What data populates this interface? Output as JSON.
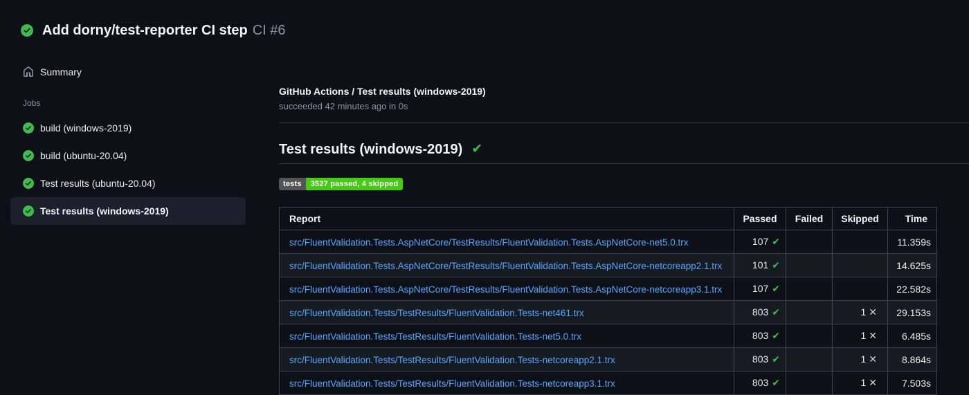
{
  "header": {
    "status_icon": "check-circle-icon",
    "title": "Add dorny/test-reporter CI step",
    "run_number": "CI #6"
  },
  "sidebar": {
    "summary_label": "Summary",
    "jobs_section_label": "Jobs",
    "jobs": [
      {
        "label": "build (windows-2019)",
        "status": "success",
        "selected": false
      },
      {
        "label": "build (ubuntu-20.04)",
        "status": "success",
        "selected": false
      },
      {
        "label": "Test results (ubuntu-20.04)",
        "status": "success",
        "selected": false
      },
      {
        "label": "Test results (windows-2019)",
        "status": "success",
        "selected": true
      }
    ]
  },
  "main": {
    "job_header": {
      "title": "GitHub Actions / Test results (windows-2019)",
      "status_line": "succeeded 42 minutes ago in 0s"
    },
    "section": {
      "title": "Test results (windows-2019)",
      "status": "success",
      "check_glyph": "✔"
    },
    "badge": {
      "label": "tests",
      "value": "3527 passed, 4 skipped",
      "label_bg": "#555555",
      "value_bg": "#44cc11"
    },
    "table": {
      "columns": [
        "Report",
        "Passed",
        "Failed",
        "Skipped",
        "Time"
      ],
      "rows": [
        {
          "report": "src/FluentValidation.Tests.AspNetCore/TestResults/FluentValidation.Tests.AspNetCore-net5.0.trx",
          "passed": "107",
          "failed": "",
          "skipped": "",
          "time": "11.359s"
        },
        {
          "report": "src/FluentValidation.Tests.AspNetCore/TestResults/FluentValidation.Tests.AspNetCore-netcoreapp2.1.trx",
          "passed": "101",
          "failed": "",
          "skipped": "",
          "time": "14.625s"
        },
        {
          "report": "src/FluentValidation.Tests.AspNetCore/TestResults/FluentValidation.Tests.AspNetCore-netcoreapp3.1.trx",
          "passed": "107",
          "failed": "",
          "skipped": "",
          "time": "22.582s"
        },
        {
          "report": "src/FluentValidation.Tests/TestResults/FluentValidation.Tests-net461.trx",
          "passed": "803",
          "failed": "",
          "skipped": "1",
          "time": "29.153s"
        },
        {
          "report": "src/FluentValidation.Tests/TestResults/FluentValidation.Tests-net5.0.trx",
          "passed": "803",
          "failed": "",
          "skipped": "1",
          "time": "6.485s"
        },
        {
          "report": "src/FluentValidation.Tests/TestResults/FluentValidation.Tests-netcoreapp2.1.trx",
          "passed": "803",
          "failed": "",
          "skipped": "1",
          "time": "8.864s"
        },
        {
          "report": "src/FluentValidation.Tests/TestResults/FluentValidation.Tests-netcoreapp3.1.trx",
          "passed": "803",
          "failed": "",
          "skipped": "1",
          "time": "7.503s"
        }
      ],
      "passed_icon_glyph": "✔",
      "skipped_icon_glyph": "✕"
    }
  },
  "colors": {
    "page_bg": "#0d1117",
    "row_alt_bg": "#161b22",
    "table_border": "#3d444d",
    "success_green": "#3fb950",
    "link_blue": "#58a6ff",
    "muted_text": "#8b949e",
    "badge_gray": "#555555",
    "badge_green": "#44cc11",
    "selected_item_bg": "#1b202a"
  }
}
